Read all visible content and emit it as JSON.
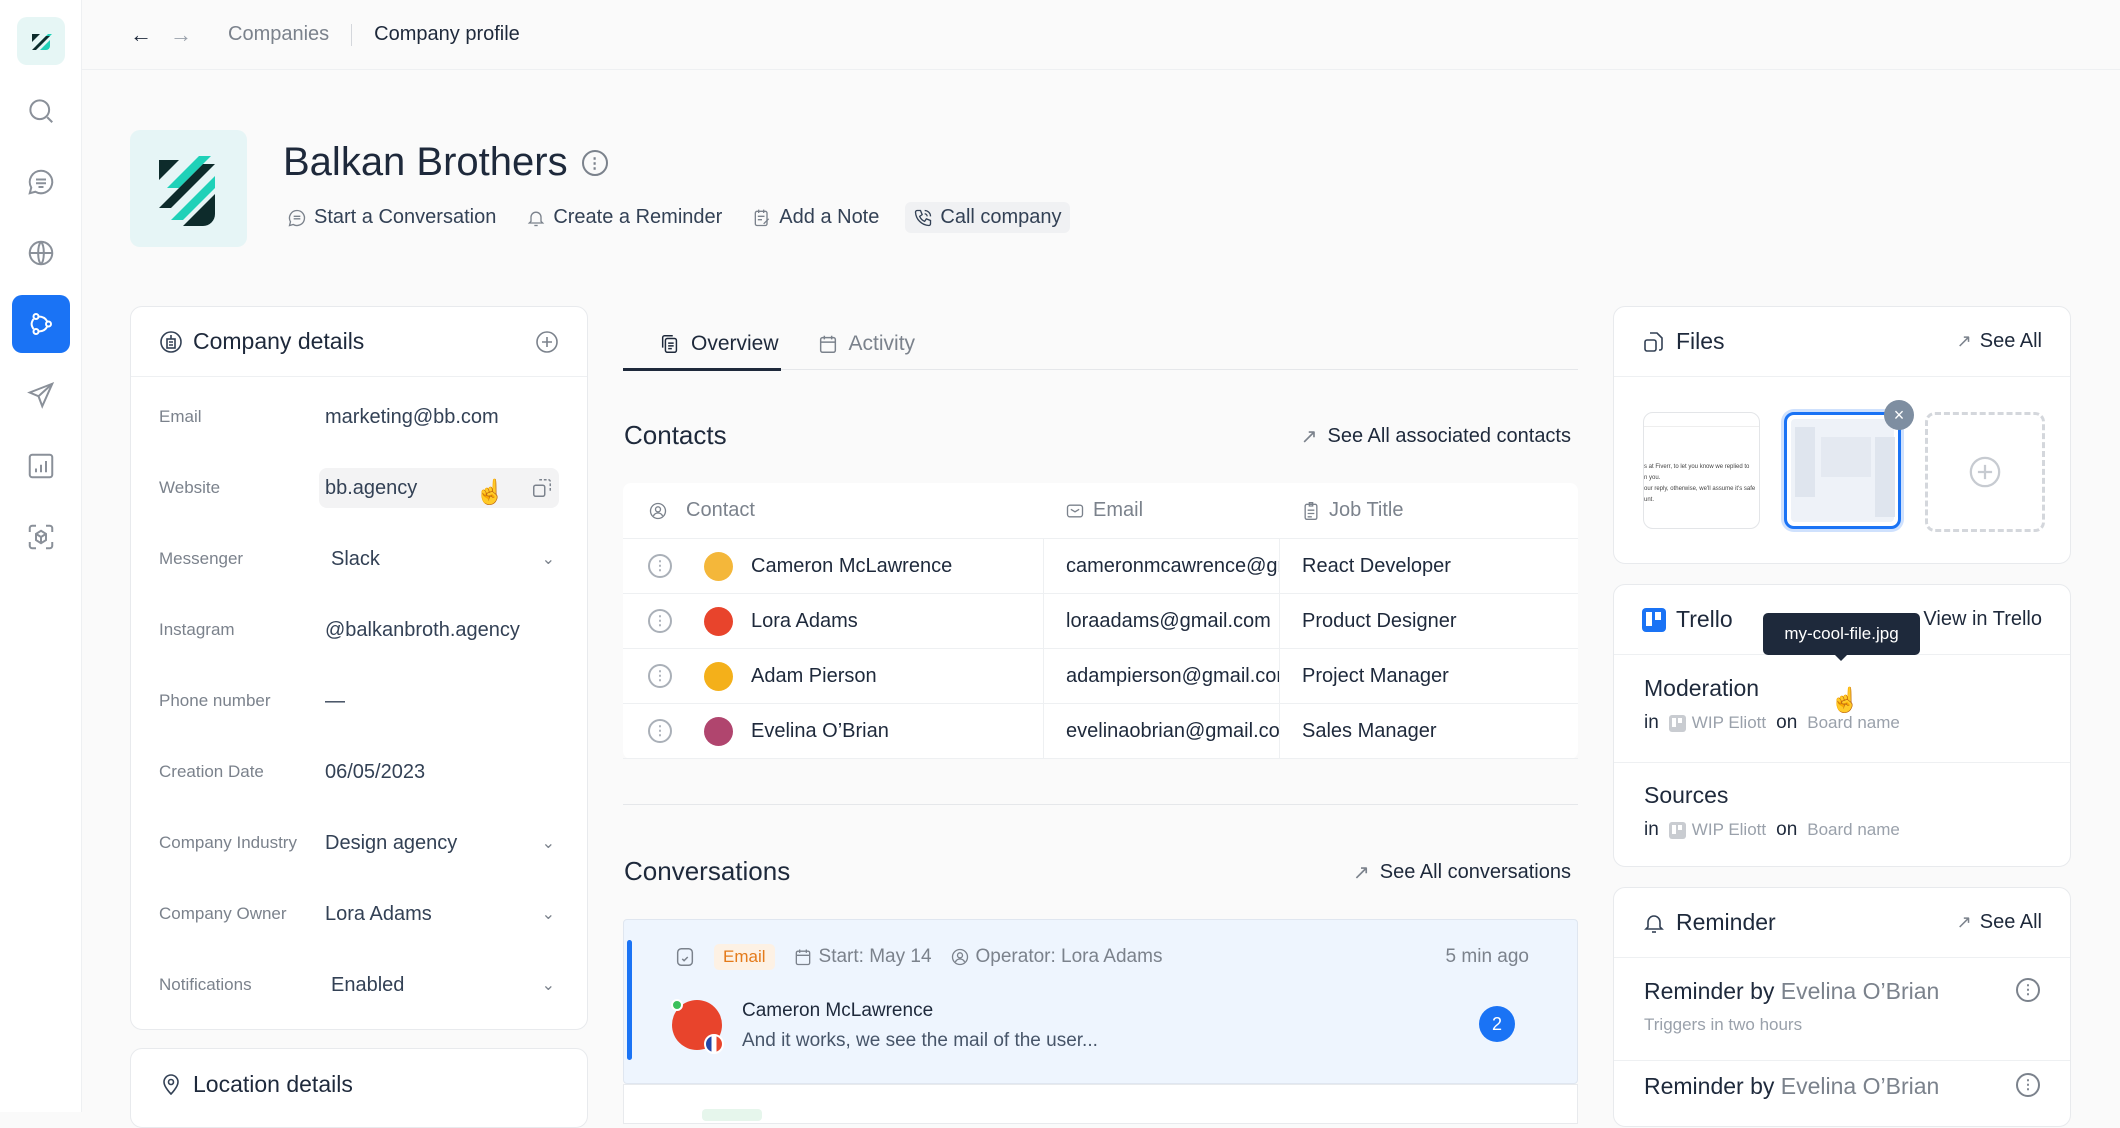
{
  "sidebar": {
    "items": [
      {
        "icon": "brand-logo-icon"
      },
      {
        "icon": "search-icon"
      },
      {
        "icon": "chat-icon"
      },
      {
        "icon": "globe-icon"
      },
      {
        "icon": "companies-icon",
        "active": true
      },
      {
        "icon": "send-icon"
      },
      {
        "icon": "reports-icon"
      },
      {
        "icon": "integrations-icon"
      }
    ]
  },
  "topbar": {
    "back": "←",
    "forward": "→",
    "breadcrumb": [
      "Companies",
      "Company profile"
    ]
  },
  "company": {
    "name": "Balkan Brothers",
    "actions": [
      {
        "label": "Start a Conversation",
        "icon": "chat-icon"
      },
      {
        "label": "Create a Reminder",
        "icon": "bell-icon"
      },
      {
        "label": "Add a Note",
        "icon": "note-icon"
      },
      {
        "label": "Call company",
        "icon": "phone-icon"
      }
    ]
  },
  "details": {
    "title": "Company details",
    "fields": [
      {
        "label": "Email",
        "value": "marketing@bb.com"
      },
      {
        "label": "Website",
        "value": "bb.agency"
      },
      {
        "label": "Messenger",
        "value": "Slack"
      },
      {
        "label": "Instagram",
        "value": "@balkanbroth.agency"
      },
      {
        "label": "Phone number",
        "value": "—"
      },
      {
        "label": "Creation Date",
        "value": "06/05/2023"
      },
      {
        "label": "Company Industry",
        "value": "Design agency"
      },
      {
        "label": "Company Owner",
        "value": "Lora Adams"
      },
      {
        "label": "Notifications",
        "value": "Enabled"
      }
    ]
  },
  "location": {
    "title": "Location details"
  },
  "tabs": [
    {
      "label": "Overview",
      "active": true
    },
    {
      "label": "Activity"
    }
  ],
  "contacts": {
    "title": "Contacts",
    "see_all": "See All associated contacts",
    "columns": [
      "Contact",
      "Email",
      "Job Title"
    ],
    "rows": [
      {
        "name": "Cameron McLawrence",
        "email": "cameronmcawrence@gmail.com",
        "job": "React Developer",
        "avatar_color": "#f4b73a"
      },
      {
        "name": "Lora Adams",
        "email": "loraadams@gmail.com",
        "job": "Product Designer",
        "avatar_color": "#e8442c"
      },
      {
        "name": "Adam Pierson",
        "email": "adampierson@gmail.com",
        "job": "Project Manager",
        "avatar_color": "#f4b01a"
      },
      {
        "name": "Evelina O’Brian",
        "email": "evelinaobrian@gmail.com",
        "job": "Sales Manager",
        "avatar_color": "#b0456e"
      }
    ]
  },
  "conversations": {
    "title": "Conversations",
    "see_all": "See All conversations",
    "items": [
      {
        "channel": "Email",
        "start": "Start: May 14",
        "operator": "Operator: Lora Adams",
        "time": "5 min ago",
        "name": "Cameron McLawrence",
        "message": "And it works, we see the mail of the user...",
        "unread": "2"
      }
    ]
  },
  "files": {
    "title": "Files",
    "see_all": "See All",
    "thumb_text": [
      "s at Fiverr, to let you know we replied to",
      "n you.",
      "our reply, otherwise, we'll assume it's safe",
      "unt."
    ],
    "tooltip": "my-cool-file.jpg"
  },
  "trello": {
    "title": "Trello",
    "link": "View in Trello",
    "items": [
      {
        "name": "Moderation",
        "in": "in",
        "list": "WIP Eliott",
        "on": "on",
        "board": "Board name"
      },
      {
        "name": "Sources",
        "in": "in",
        "list": "WIP Eliott",
        "on": "on",
        "board": "Board name"
      }
    ]
  },
  "reminder": {
    "title": "Reminder",
    "see_all": "See All",
    "items": [
      {
        "prefix": "Reminder by",
        "who": "Evelina O’Brian",
        "sub": "Triggers in two hours"
      },
      {
        "prefix": "Reminder by",
        "who": "Evelina O’Brian",
        "sub": ""
      }
    ]
  },
  "colors": {
    "accent": "#1a73f5",
    "brand": "#1fd1b8",
    "email_badge": "#e47a1a"
  }
}
